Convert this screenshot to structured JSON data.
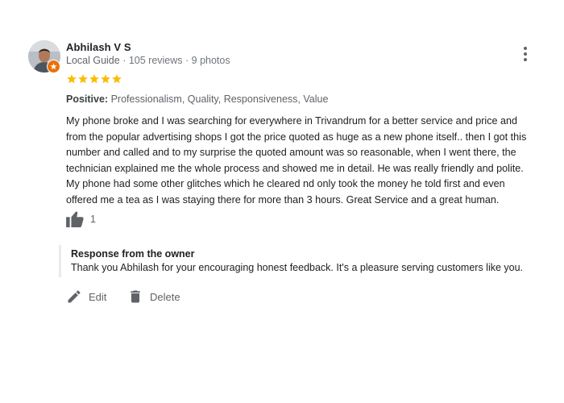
{
  "review": {
    "author": {
      "name": "Abhilash V S",
      "level": "Local Guide",
      "separator1": " · ",
      "reviews": "105 reviews",
      "separator2": " · ",
      "photos": "9 photos",
      "badge_color": "#e8710a"
    },
    "rating": {
      "stars": 5,
      "max": 5,
      "color": "#fbbc04"
    },
    "positive": {
      "label": "Positive:",
      "value": "Professionalism, Quality, Responsiveness, Value"
    },
    "text": "My phone broke and I was searching for everywhere in Trivandrum for a better service and price and\nfrom the popular advertising shops I got the price quoted as huge as a new phone itself.. then I got this\nnumber and called and to my surprise the quoted amount was so reasonable, when I went there, the\ntechnician explained me the whole process and showed me in detail.  He was really friendly and polite.\nMy phone had some other glitches which he cleared nd only took the money he told first and even\noffered me a tea as I was staying there for more than 3 hours. Great Service and a great human.",
    "likes": {
      "icon": "thumbs-up-icon",
      "count": "1"
    },
    "menu_icon": "more-vertical-icon"
  },
  "owner_response": {
    "title": "Response from the owner",
    "text": "Thank you Abhilash for your encouraging honest feedback. It's a pleasure serving customers like you."
  },
  "actions": {
    "edit": {
      "label": "Edit",
      "icon": "pencil-icon"
    },
    "delete": {
      "label": "Delete",
      "icon": "trash-icon"
    }
  }
}
